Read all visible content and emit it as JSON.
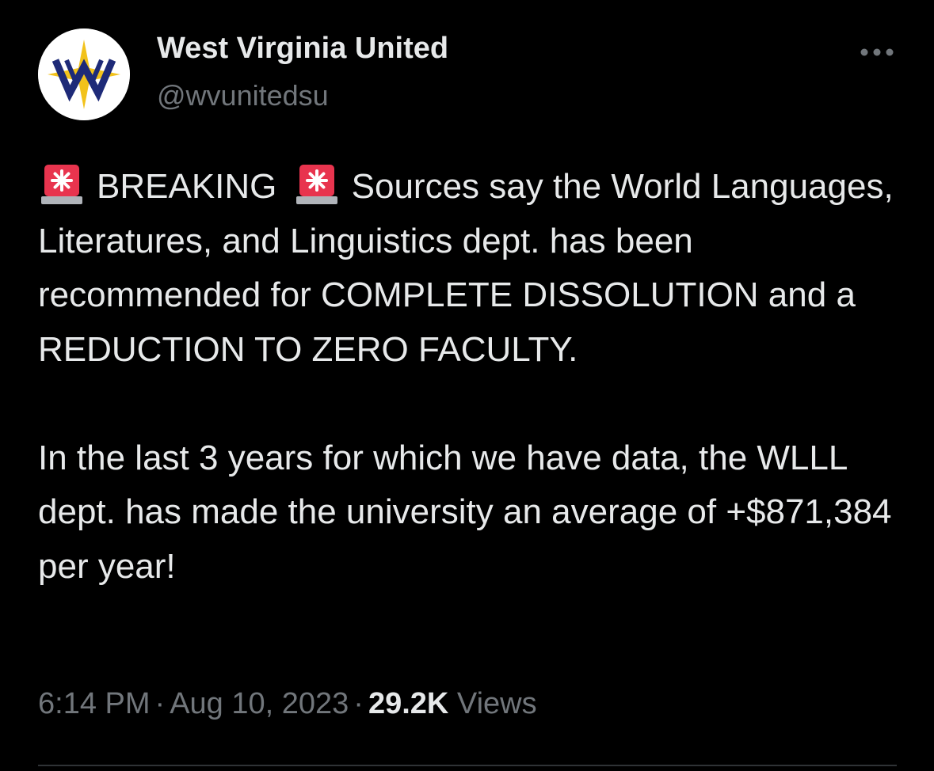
{
  "author": {
    "display_name": "West Virginia United",
    "handle": "@wvunitedsu",
    "avatar_icon": "wv-united-logo-icon"
  },
  "more_icon": "more-horizontal-icon",
  "tweet": {
    "line1_a": "BREAKING",
    "line1_b": "Sources say the World",
    "para1_rest": "Languages, Literatures, and Linguistics dept. has been recommended for COMPLETE DISSOLUTION and a REDUCTION TO ZERO FACULTY.",
    "para2": "In the last 3 years for which we have data, the WLLL dept. has made the university an average of +$871,384 per year!",
    "emoji_icon": "police-car-light-icon"
  },
  "meta": {
    "time": "6:14 PM",
    "separator": "·",
    "date": "Aug 10, 2023",
    "views_count": "29.2K",
    "views_label": "Views"
  },
  "colors": {
    "background": "#000000",
    "text_primary": "#e7e9ea",
    "text_secondary": "#71767b",
    "divider": "#2f3336",
    "logo_navy": "#1e2a78",
    "logo_gold": "#f2c21b",
    "siren_red": "#e8344e"
  }
}
